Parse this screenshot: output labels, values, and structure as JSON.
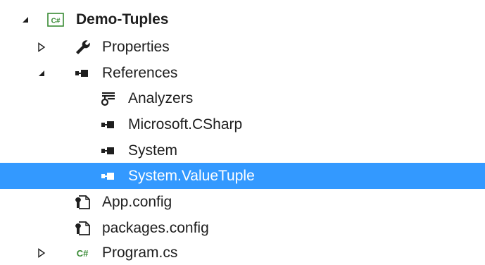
{
  "solution_explorer": {
    "project": {
      "label": "Demo-Tuples",
      "icon": "csharp-project-icon",
      "expanded": true,
      "children": {
        "properties": {
          "label": "Properties",
          "icon": "wrench-icon",
          "expanded": false
        },
        "references": {
          "label": "References",
          "icon": "references-icon",
          "expanded": true,
          "items": [
            {
              "label": "Analyzers",
              "icon": "analyzers-icon"
            },
            {
              "label": "Microsoft.CSharp",
              "icon": "reference-icon"
            },
            {
              "label": "System",
              "icon": "reference-icon"
            },
            {
              "label": "System.ValueTuple",
              "icon": "reference-icon",
              "selected": true
            }
          ]
        },
        "app_config": {
          "label": "App.config",
          "icon": "config-file-icon"
        },
        "packages_config": {
          "label": "packages.config",
          "icon": "config-file-icon"
        },
        "program_cs": {
          "label": "Program.cs",
          "icon": "csharp-file-icon",
          "expanded": false,
          "icon_text": "C#"
        }
      }
    },
    "project_icon_text": "C#",
    "colors": {
      "selection": "#3399ff",
      "text": "#1e1e1e",
      "csharp_green": "#388a34",
      "icon_dark": "#1e1e1e"
    }
  }
}
